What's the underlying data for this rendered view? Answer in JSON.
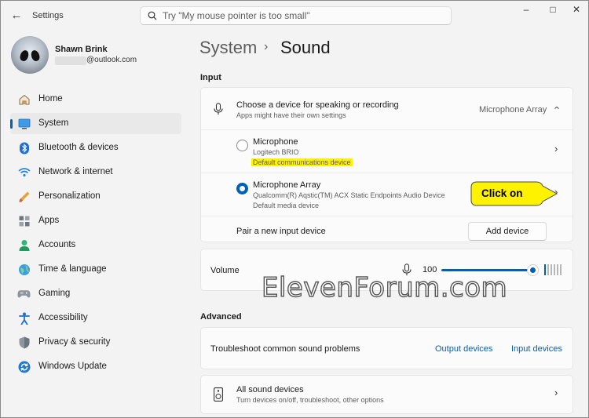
{
  "window": {
    "app_title": "Settings"
  },
  "search": {
    "placeholder": "Try \"My mouse pointer is too small\""
  },
  "profile": {
    "name": "Shawn Brink",
    "email": "@outlook.com"
  },
  "nav": {
    "items": [
      {
        "label": "Home",
        "icon": "home-icon",
        "active": false
      },
      {
        "label": "System",
        "icon": "system-icon",
        "active": true
      },
      {
        "label": "Bluetooth & devices",
        "icon": "bluetooth-icon",
        "active": false
      },
      {
        "label": "Network & internet",
        "icon": "network-icon",
        "active": false
      },
      {
        "label": "Personalization",
        "icon": "personalization-icon",
        "active": false
      },
      {
        "label": "Apps",
        "icon": "apps-icon",
        "active": false
      },
      {
        "label": "Accounts",
        "icon": "accounts-icon",
        "active": false
      },
      {
        "label": "Time & language",
        "icon": "time-language-icon",
        "active": false
      },
      {
        "label": "Gaming",
        "icon": "gaming-icon",
        "active": false
      },
      {
        "label": "Accessibility",
        "icon": "accessibility-icon",
        "active": false
      },
      {
        "label": "Privacy & security",
        "icon": "privacy-shield-icon",
        "active": false
      },
      {
        "label": "Windows Update",
        "icon": "windows-update-icon",
        "active": false
      }
    ]
  },
  "breadcrumb": {
    "parent": "System",
    "current": "Sound"
  },
  "input_section": {
    "heading": "Input",
    "choose_device": {
      "title": "Choose a device for speaking or recording",
      "subtitle": "Apps might have their own settings",
      "selected": "Microphone Array"
    },
    "devices": [
      {
        "name": "Microphone",
        "detail": "Logitech BRIO",
        "status": "Default communications device",
        "selected": false
      },
      {
        "name": "Microphone Array",
        "detail": "Qualcomm(R) Aqstic(TM) ACX Static Endpoints Audio Device",
        "status": "Default media device",
        "selected": true
      }
    ],
    "pair": {
      "label": "Pair a new input device",
      "button": "Add device"
    }
  },
  "volume": {
    "label": "Volume",
    "value": "100",
    "level": 1.0
  },
  "advanced": {
    "heading": "Advanced",
    "troubleshoot": {
      "label": "Troubleshoot common sound problems",
      "link_output": "Output devices",
      "link_input": "Input devices"
    },
    "all_devices": {
      "title": "All sound devices",
      "subtitle": "Turn devices on/off, troubleshoot, other options"
    }
  },
  "callout": {
    "text": "Click on",
    "color": "#fff200"
  },
  "watermark": {
    "text": "ElevenForum.com"
  },
  "colors": {
    "accent": "#005fb8",
    "highlight": "#fff200"
  }
}
